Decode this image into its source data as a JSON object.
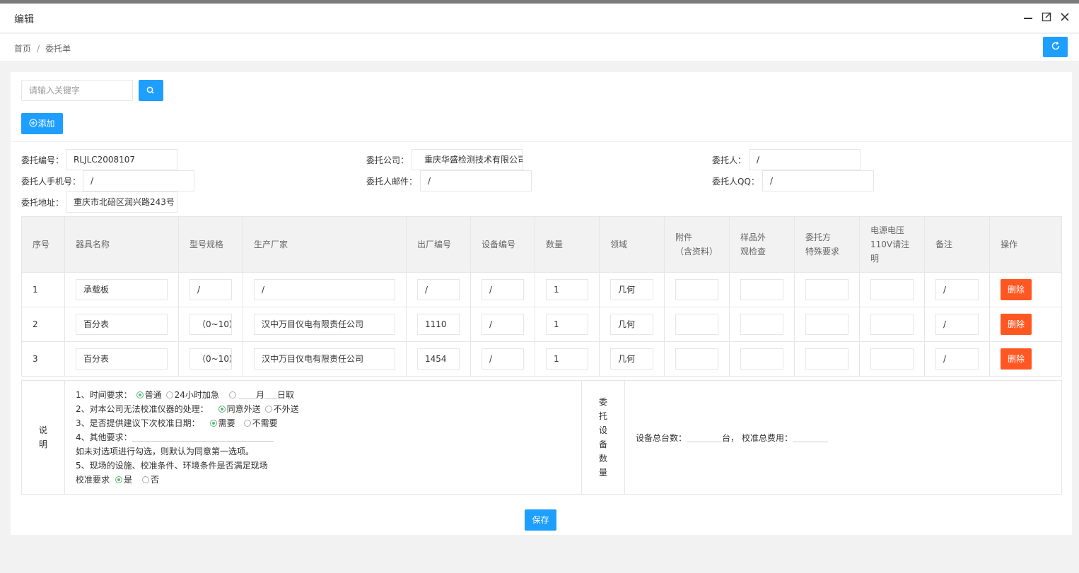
{
  "window": {
    "title": "编辑"
  },
  "breadcrumb": {
    "home": "首页",
    "separator": "/",
    "current": "委托单"
  },
  "toolbar": {
    "search_placeholder": "请输入关键字",
    "add_label": "添加",
    "add_icon": "plus-circle-icon",
    "search_icon": "search-icon",
    "refresh_icon": "refresh-icon"
  },
  "form": {
    "entrust_no_label": "委托编号：",
    "entrust_no": "RLJLC2008107",
    "company_label": "委托公司：",
    "company": "重庆华盛检测技术有限公司",
    "person_label": "委托人：",
    "person": "/",
    "phone_label": "委托人手机号：",
    "phone": "/",
    "email_label": "委托人邮件：",
    "email": "/",
    "qq_label": "委托人QQ：",
    "qq": "/",
    "address_label": "委托地址：",
    "address": "重庆市北碚区润兴路243号"
  },
  "table": {
    "headers": {
      "seq": "序号",
      "name": "器具名称",
      "model": "型号规格",
      "maker": "生产厂家",
      "serial": "出厂编号",
      "device_no": "设备编号",
      "qty": "数量",
      "field": "领域",
      "attach_1": "附件",
      "attach_2": "（含资料）",
      "check_1": "样品外",
      "check_2": "观检查",
      "special_1": "委托方",
      "special_2": "特殊要求",
      "voltage_1": "电源电压",
      "voltage_2": "110V请注",
      "voltage_3": "明",
      "remark": "备注",
      "op": "操作"
    },
    "delete_label": "删除",
    "rows": [
      {
        "seq": "1",
        "name": "承载板",
        "model": "/",
        "maker": "/",
        "serial": "/",
        "device_no": "/",
        "qty": "1",
        "field": "几何",
        "attach": "",
        "check": "",
        "special": "",
        "voltage": "",
        "remark": "/"
      },
      {
        "seq": "2",
        "name": "百分表",
        "model": "（0~10）",
        "maker": "汉中万目仪电有限责任公司",
        "serial": "1110",
        "device_no": "/",
        "qty": "1",
        "field": "几何",
        "attach": "",
        "check": "",
        "special": "",
        "voltage": "",
        "remark": "/"
      },
      {
        "seq": "3",
        "name": "百分表",
        "model": "（0~10）",
        "maker": "汉中万目仪电有限责任公司",
        "serial": "1454",
        "device_no": "/",
        "qty": "1",
        "field": "几何",
        "attach": "",
        "check": "",
        "special": "",
        "voltage": "",
        "remark": "/"
      }
    ]
  },
  "notes": {
    "side_1": "说",
    "side_2": "明",
    "time_req": "1、时间要求：",
    "opt_normal": "普通",
    "opt_24h": "24小时加急",
    "month": "月",
    "day": "日取",
    "handling": "2、对本公司无法校准仪器的处理：",
    "opt_outsource": "同意外送",
    "opt_no_outsource": "不外送",
    "next_date": "3、是否提供建议下次校准日期：",
    "opt_need": "需要",
    "opt_no_need": "不需要",
    "other_req": "4、其他要求：",
    "default_note": "如未对选项进行勾选，则默认为同意第一选项。",
    "site_1": "5、现场的设施、校准条件、环境条件是否满足现场",
    "site_2": "校准要求",
    "opt_yes": "是",
    "opt_no": "否",
    "count_col": [
      "委",
      "托",
      "设",
      "备",
      "数",
      "量"
    ],
    "total_devices": "设备总台数：",
    "unit": "台，",
    "total_fee": "校准总费用："
  },
  "save_label": "保存"
}
